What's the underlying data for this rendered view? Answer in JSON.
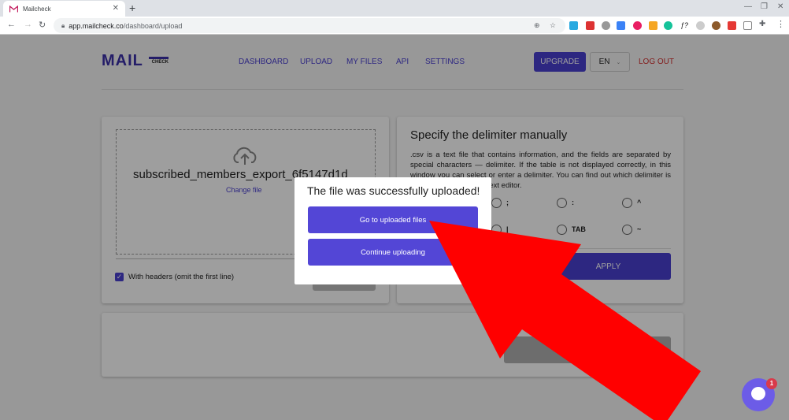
{
  "browser": {
    "tab_title": "Mailcheck",
    "url_host": "app.mailcheck.co",
    "url_path": "/dashboard/upload",
    "icons": [
      "back-icon",
      "forward-icon",
      "reload-icon",
      "lock-icon",
      "zoom-icon",
      "bookmark-star-icon",
      "extensions-puzzle-icon",
      "menu-dots-icon"
    ]
  },
  "header": {
    "logo_main": "MAIL",
    "logo_sub": "CHECK",
    "nav": [
      "DASHBOARD",
      "UPLOAD",
      "MY FILES",
      "API",
      "SETTINGS"
    ],
    "upgrade_label": "UPGRADE",
    "language": "EN",
    "logout_label": "LOG OUT"
  },
  "upload_card": {
    "file_name": "subscribed_members_export_6f5147d1d",
    "change_file_label": "Change file",
    "with_headers_label": "With headers (omit the first line)",
    "with_headers_checked": true
  },
  "delimiter_card": {
    "title": "Specify the delimiter manually",
    "description": ".csv is a text file that contains information, and the fields are separated by special characters — delimiter. If the table is not displayed correctly, in this window you can select or enter a delimiter. You can find out which delimiter is used by opening it in a text editor.",
    "options": [
      ";",
      ":",
      "^",
      "|",
      "TAB",
      "~"
    ],
    "apply_label": "APPLY"
  },
  "modal": {
    "title": "The file was successfully uploaded!",
    "primary_label": "Go to uploaded files",
    "secondary_label": "Continue uploading"
  },
  "chat": {
    "badge_count": "1"
  },
  "colors": {
    "brand": "#4a3fd1",
    "modal_button": "#5346d6",
    "logout": "#d32f2f",
    "annotation_arrow": "#ff0000"
  }
}
